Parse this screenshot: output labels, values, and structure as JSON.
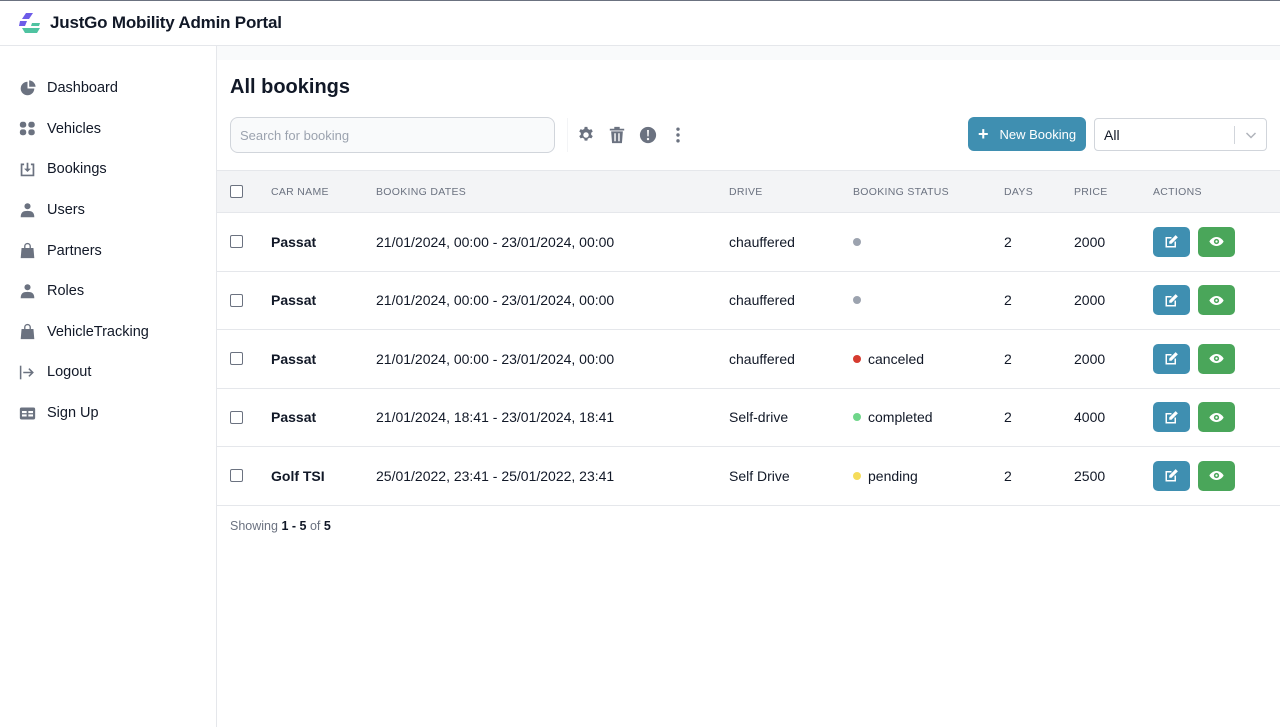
{
  "app": {
    "title": "JustGo Mobility Admin Portal",
    "colors": {
      "primary": "#3f8fb1",
      "success": "#4aa65a",
      "logo_purple": "#6d5ce8",
      "logo_teal": "#4fc3a1"
    }
  },
  "sidebar": {
    "items": [
      {
        "label": "Dashboard",
        "icon": "pie-chart-icon"
      },
      {
        "label": "Vehicles",
        "icon": "grid-icon"
      },
      {
        "label": "Bookings",
        "icon": "inbox-download-icon"
      },
      {
        "label": "Users",
        "icon": "user-icon"
      },
      {
        "label": "Partners",
        "icon": "shopping-bag-icon"
      },
      {
        "label": "Roles",
        "icon": "user-icon"
      },
      {
        "label": "VehicleTracking",
        "icon": "shopping-bag-icon"
      },
      {
        "label": "Logout",
        "icon": "logout-arrow-icon"
      },
      {
        "label": "Sign Up",
        "icon": "table-card-icon"
      }
    ]
  },
  "page": {
    "title": "All bookings",
    "search": {
      "placeholder": "Search for booking",
      "value": ""
    },
    "toolbar": {
      "settings_icon": "gear-icon",
      "delete_icon": "trash-icon",
      "alert_icon": "exclamation-circle-icon",
      "more_icon": "dots-vertical-icon"
    },
    "new_booking_label": "New Booking",
    "filter": {
      "selected": "All"
    }
  },
  "table": {
    "headers": [
      "Car Name",
      "Booking Dates",
      "Drive",
      "Booking Status",
      "Days",
      "Price",
      "Actions"
    ],
    "rows": [
      {
        "car": "Passat",
        "dates": "21/01/2024, 00:00 - 23/01/2024, 00:00",
        "drive": "chauffered",
        "status": "",
        "status_color": "#9ca3af",
        "days": "2",
        "price": "2000"
      },
      {
        "car": "Passat",
        "dates": "21/01/2024, 00:00 - 23/01/2024, 00:00",
        "drive": "chauffered",
        "status": "",
        "status_color": "#9ca3af",
        "days": "2",
        "price": "2000"
      },
      {
        "car": "Passat",
        "dates": "21/01/2024, 00:00 - 23/01/2024, 00:00",
        "drive": "chauffered",
        "status": "canceled",
        "status_color": "#d63b2f",
        "days": "2",
        "price": "2000"
      },
      {
        "car": "Passat",
        "dates": "21/01/2024, 18:41 - 23/01/2024, 18:41",
        "drive": "Self-drive",
        "status": "completed",
        "status_color": "#6fd68a",
        "days": "2",
        "price": "4000"
      },
      {
        "car": "Golf TSI",
        "dates": "25/01/2022, 23:41 - 25/01/2022, 23:41",
        "drive": "Self Drive",
        "status": "pending",
        "status_color": "#f5dc5a",
        "days": "2",
        "price": "2500"
      }
    ]
  },
  "pagination": {
    "prefix": "Showing",
    "range": "1 - 5",
    "of_label": "of",
    "total": "5"
  }
}
